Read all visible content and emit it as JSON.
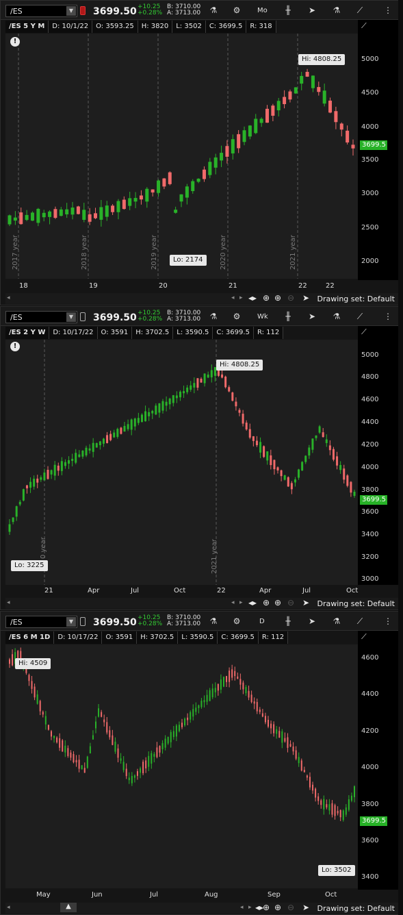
{
  "common": {
    "symbol": "/ES",
    "price": "3699.50",
    "change": "+10.25",
    "change_pct": "+0.28%",
    "bid": "B: 3710.00",
    "ask": "A: 3713.00",
    "drawing_set": "Drawing set: Default",
    "last_price_label": "3699.5",
    "colors": {
      "up": "#29b229",
      "down": "#f06a6a",
      "last_price_bg": "#27b227"
    }
  },
  "panels": [
    {
      "aggregation": "Mo",
      "info": [
        "/ES 5 Y M",
        "D: 10/1/22",
        "O: 3593.25",
        "H: 3820",
        "L: 3502",
        "C: 3699.5",
        "R: 318"
      ],
      "y_ticks": [
        "5000",
        "4500",
        "4000",
        "3500",
        "3000",
        "2500",
        "2000"
      ],
      "x_ticks": [
        "18",
        "19",
        "20",
        "21",
        "22"
      ],
      "year_markers": [
        "2017 year",
        "2018 year",
        "2019 year",
        "2020 year",
        "2021 year"
      ],
      "hi_label": "Hi: 4808.25",
      "lo_label": "Lo: 2174",
      "link_icon": "link-red-icon"
    },
    {
      "aggregation": "Wk",
      "info": [
        "/ES 2 Y W",
        "D: 10/17/22",
        "O: 3591",
        "H: 3702.5",
        "L: 3590.5",
        "C: 3699.5",
        "R: 112"
      ],
      "y_ticks": [
        "5000",
        "4800",
        "4600",
        "4400",
        "4200",
        "4000",
        "3800",
        "3600",
        "3400",
        "3200",
        "3000"
      ],
      "x_ticks": [
        "21",
        "Apr",
        "Jul",
        "Oct",
        "22",
        "Apr",
        "Jul",
        "Oct"
      ],
      "year_markers": [
        "2021 year"
      ],
      "hi_label": "Hi: 4808.25",
      "lo_label": "Lo: 3225",
      "link_icon": "link-icon"
    },
    {
      "aggregation": "D",
      "info": [
        "/ES 6 M 1D",
        "D: 10/17/22",
        "O: 3591",
        "H: 3702.5",
        "L: 3590.5",
        "C: 3699.5",
        "R: 112"
      ],
      "y_ticks": [
        "4600",
        "4400",
        "4200",
        "4000",
        "3800",
        "3600",
        "3400"
      ],
      "x_ticks": [
        "May",
        "Jun",
        "Jul",
        "Aug",
        "Sep",
        "Oct"
      ],
      "year_markers": [],
      "hi_label": "Hi: 4509",
      "lo_label": "Lo: 3502",
      "link_icon": "link-icon"
    }
  ]
}
